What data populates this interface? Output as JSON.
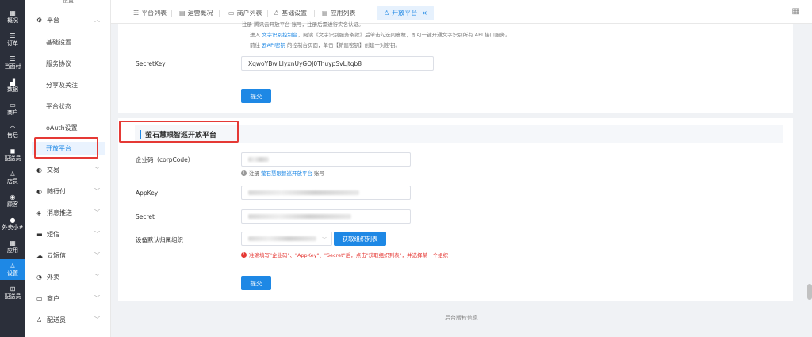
{
  "rail": {
    "items": [
      {
        "icon": "▦",
        "label": "概况"
      },
      {
        "icon": "☰",
        "label": "订单"
      },
      {
        "icon": "☰",
        "label": "当面付"
      },
      {
        "icon": "▟",
        "label": "数据"
      },
      {
        "icon": "▭",
        "label": "商户"
      },
      {
        "icon": "◠",
        "label": "售后"
      },
      {
        "icon": "◼",
        "label": "配送员"
      },
      {
        "icon": "♙",
        "label": "店员"
      },
      {
        "icon": "◉",
        "label": "顾客"
      },
      {
        "icon": "●",
        "label": "外卖小#"
      },
      {
        "icon": "▦",
        "label": "应用"
      },
      {
        "icon": "♙",
        "label": "设置"
      },
      {
        "icon": "⊞",
        "label": "配送员"
      }
    ]
  },
  "submenu": {
    "top_label": "设置",
    "group_platform": "平台",
    "items": [
      "基础设置",
      "服务协议",
      "分享及关注",
      "平台状态",
      "oAuth设置",
      "开放平台"
    ],
    "groups": [
      "交易",
      "随行付",
      "消息推送",
      "短信",
      "云短信",
      "外卖",
      "商户",
      "配送员"
    ]
  },
  "tabs": [
    {
      "icon": "☷",
      "label": "平台列表"
    },
    {
      "icon": "▤",
      "label": "运营概况"
    },
    {
      "icon": "▭",
      "label": "商户列表"
    },
    {
      "icon": "♙",
      "label": "基础设置"
    },
    {
      "icon": "▤",
      "label": "应用列表"
    },
    {
      "icon": "♙",
      "label": "开放平台",
      "close": "×"
    }
  ],
  "top_card": {
    "hint_line_1": "注册 腾讯云开放平台 账号，注册后需进行实名认证。",
    "hint_line_2_pre": "进入",
    "hint_line_2_link": "文字识别控制台",
    "hint_line_2_post": "，阅读《文字识别服务条款》后单击勾选同意框，即可一键开通文字识别所有 API 接口服务。",
    "hint_line_3_pre": "前往",
    "hint_line_3_link": "云API密钥",
    "hint_line_3_post": "的控制台页面，单击【新建密钥】创建一对密钥。",
    "secret_key_label": "SecretKey",
    "secret_key_value": "XqwoYBwiLlyxnUyGOJ0ThuypSvLjtqb8",
    "submit_label": "提交"
  },
  "bottom_card": {
    "section_title": "萤石慧眼智巡开放平台",
    "corp_code_label": "企业码（corpCode）",
    "corp_hint_pre": "注册",
    "corp_hint_link": "萤石慧眼智巡开放平台",
    "corp_hint_post": "账号",
    "appkey_label": "AppKey",
    "secret_label": "Secret",
    "org_label": "设备默认归属组织",
    "fetch_button": "获取组织列表",
    "error_hint": "准确填写\"企业码\"、\"AppKey\"、\"Secret\"后，点击\"获取组织列表\"，并选择某一个组织",
    "submit_label": "提交"
  },
  "footer": "后台版权信息"
}
